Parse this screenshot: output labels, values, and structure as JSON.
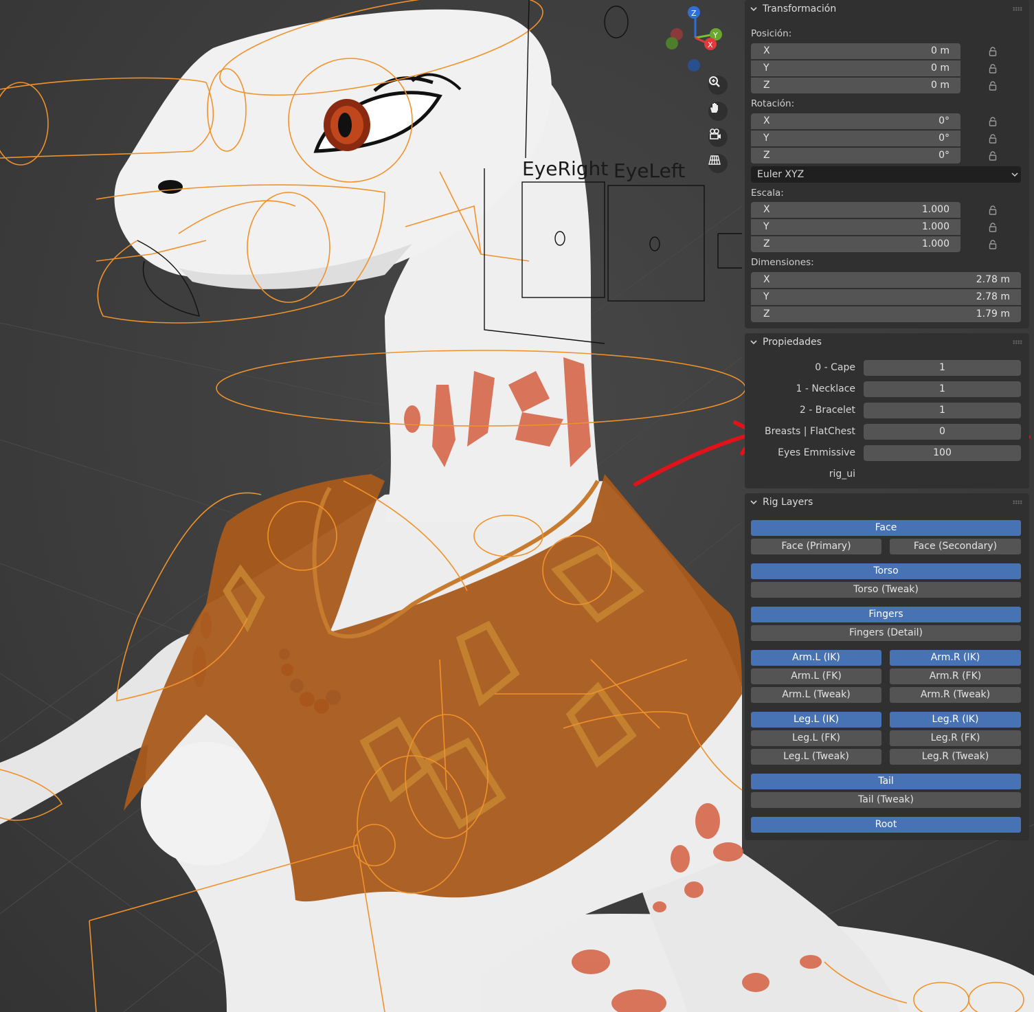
{
  "viewport": {
    "labels": [
      "EyeRight",
      "EyeLeft"
    ],
    "gizmo_axes": [
      "Z",
      "Y",
      "X"
    ],
    "nav_icons": [
      "zoom-icon",
      "pan-hand-icon",
      "camera-icon",
      "grid-icon"
    ]
  },
  "transform": {
    "title": "Transformación",
    "position_label": "Posición:",
    "position": [
      {
        "axis": "X",
        "value": "0 m"
      },
      {
        "axis": "Y",
        "value": "0 m"
      },
      {
        "axis": "Z",
        "value": "0 m"
      }
    ],
    "rotation_label": "Rotación:",
    "rotation": [
      {
        "axis": "X",
        "value": "0°"
      },
      {
        "axis": "Y",
        "value": "0°"
      },
      {
        "axis": "Z",
        "value": "0°"
      }
    ],
    "rotation_mode": "Euler XYZ",
    "scale_label": "Escala:",
    "scale": [
      {
        "axis": "X",
        "value": "1.000"
      },
      {
        "axis": "Y",
        "value": "1.000"
      },
      {
        "axis": "Z",
        "value": "1.000"
      }
    ],
    "dimensions_label": "Dimensiones:",
    "dimensions": [
      {
        "axis": "X",
        "value": "2.78 m"
      },
      {
        "axis": "Y",
        "value": "2.78 m"
      },
      {
        "axis": "Z",
        "value": "1.79 m"
      }
    ]
  },
  "properties": {
    "title": "Propiedades",
    "items": [
      {
        "label": "0 - Cape",
        "value": "1"
      },
      {
        "label": "1 - Necklace",
        "value": "1"
      },
      {
        "label": "2 - Bracelet",
        "value": "1"
      },
      {
        "label": "Breasts | FlatChest",
        "value": "0"
      },
      {
        "label": "Eyes Emmissive",
        "value": "100"
      },
      {
        "label": "rig_ui",
        "value": null
      }
    ]
  },
  "rig_layers": {
    "title": "Rig Layers",
    "buttons": {
      "face": "Face",
      "face_primary": "Face (Primary)",
      "face_secondary": "Face (Secondary)",
      "torso": "Torso",
      "torso_tweak": "Torso (Tweak)",
      "fingers": "Fingers",
      "fingers_detail": "Fingers (Detail)",
      "arm_l_ik": "Arm.L (IK)",
      "arm_r_ik": "Arm.R (IK)",
      "arm_l_fk": "Arm.L (FK)",
      "arm_r_fk": "Arm.R (FK)",
      "arm_l_tweak": "Arm.L (Tweak)",
      "arm_r_tweak": "Arm.R (Tweak)",
      "leg_l_ik": "Leg.L (IK)",
      "leg_r_ik": "Leg.R (IK)",
      "leg_l_fk": "Leg.L (FK)",
      "leg_r_fk": "Leg.R (FK)",
      "leg_l_tweak": "Leg.L (Tweak)",
      "leg_r_tweak": "Leg.R (Tweak)",
      "tail": "Tail",
      "tail_tweak": "Tail (Tweak)",
      "root": "Root"
    }
  },
  "colors": {
    "accent": "#4772b3",
    "rig_orange": "#f0922b",
    "annotation_red": "#e0121a",
    "cape_brown": "#b5651d"
  }
}
